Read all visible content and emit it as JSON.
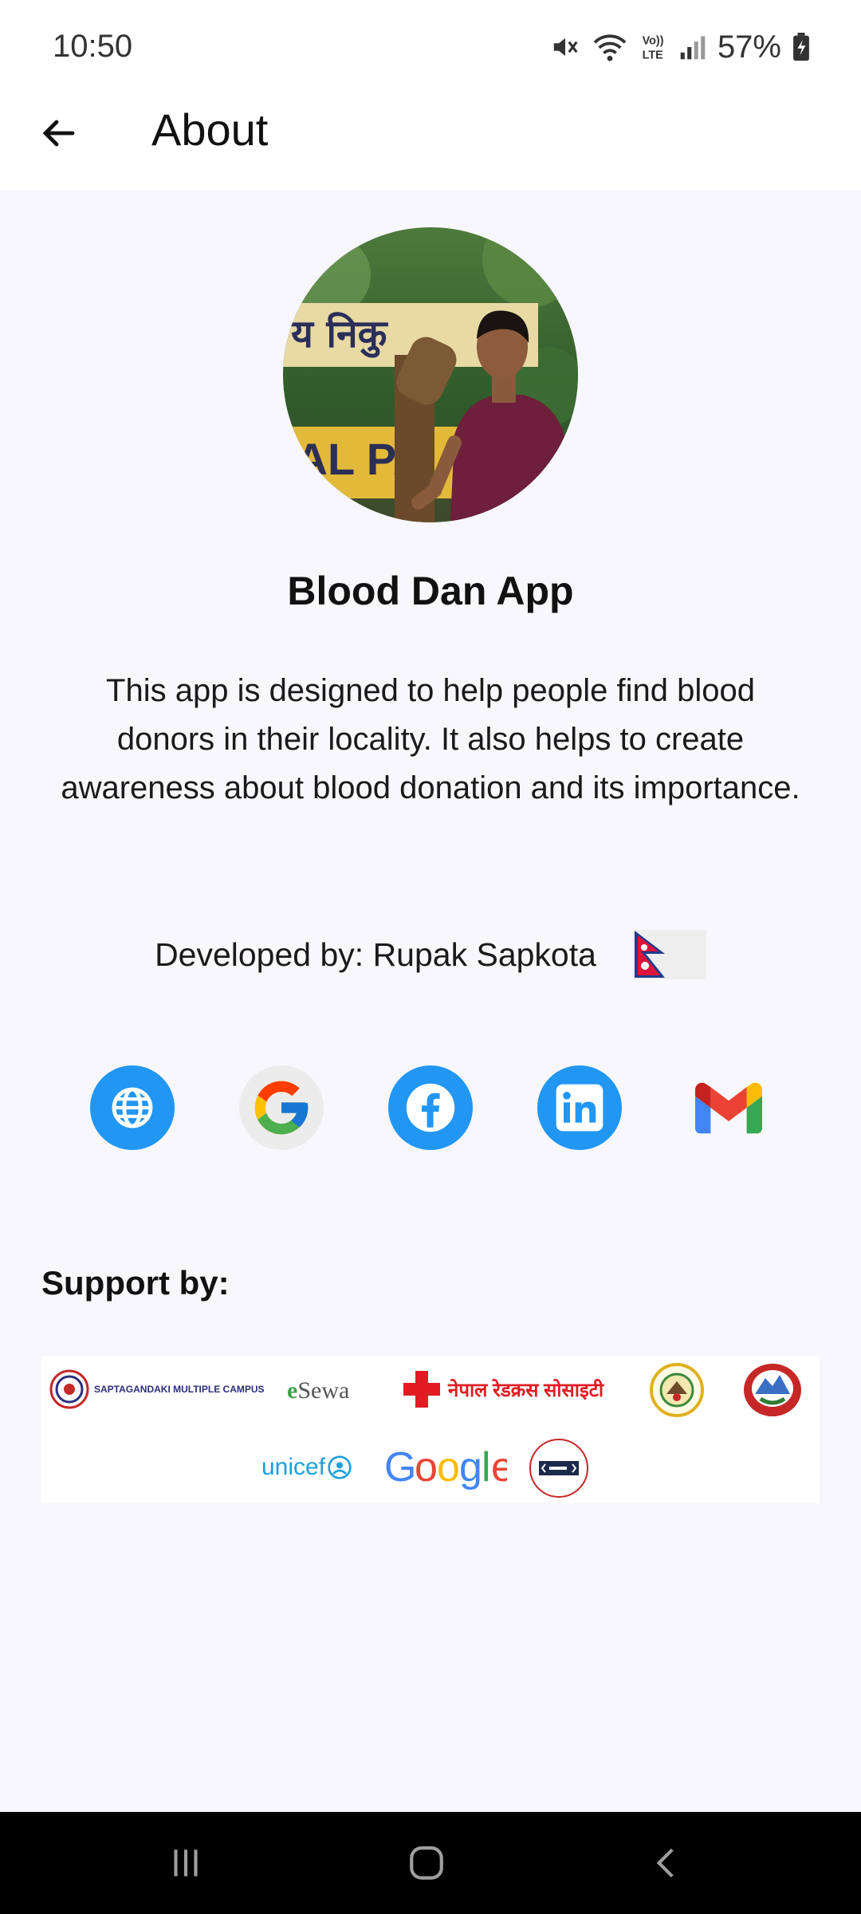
{
  "status_bar": {
    "time": "10:50",
    "battery": "57%",
    "icons": [
      "mute-icon",
      "wifi-icon",
      "volte-icon",
      "signal-icon",
      "battery-icon"
    ]
  },
  "app_bar": {
    "title": "About",
    "back_icon": "arrow-left-icon"
  },
  "profile": {
    "app_name": "Blood Dan App",
    "description": "This app is designed to help people find blood donors in their locality. It also helps to create awareness about blood donation and its importance.",
    "developer": "Developed by: Rupak Sapkota",
    "flag": "nepal-flag"
  },
  "social_links": [
    {
      "name": "website",
      "icon": "globe-icon",
      "color": "#2196f3"
    },
    {
      "name": "google",
      "icon": "google-icon",
      "color": "#ececec"
    },
    {
      "name": "facebook",
      "icon": "facebook-icon",
      "color": "#2196f3"
    },
    {
      "name": "linkedin",
      "icon": "linkedin-icon",
      "color": "#2196f3"
    },
    {
      "name": "gmail",
      "icon": "gmail-icon",
      "color": "transparent"
    }
  ],
  "support": {
    "label": "Support by:",
    "sponsors": {
      "campus": "SAPTAGANDAKI MULTIPLE CAMPUS",
      "esewa_e": "e",
      "esewa_rest": "Sewa",
      "redcross": "नेपाल रेडक्रस सोसाइटी",
      "unicef": "unicef",
      "google": "Google"
    }
  },
  "nav_bar": {
    "icons": [
      "recents-icon",
      "home-icon",
      "back-icon"
    ]
  },
  "colors": {
    "accent_blue": "#2196f3",
    "background": "#f8f7fc",
    "text": "#111111"
  }
}
